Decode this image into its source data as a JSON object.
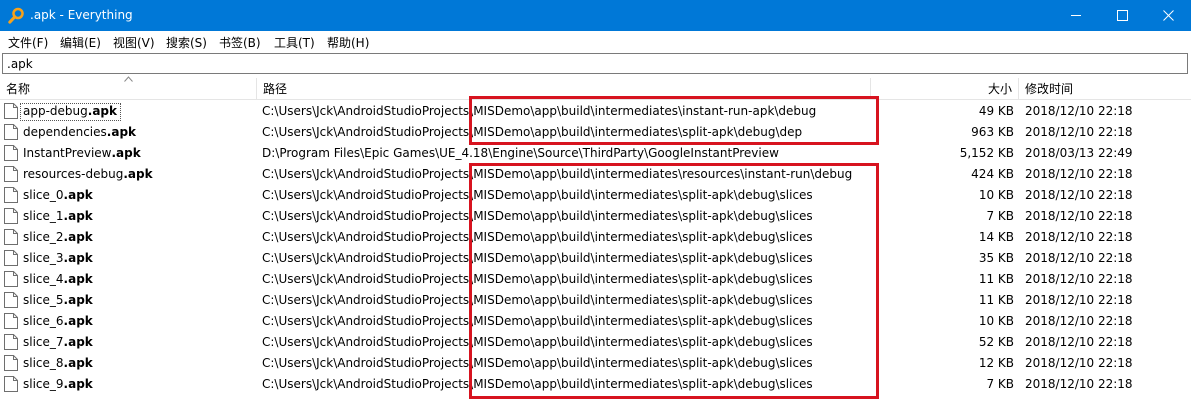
{
  "window": {
    "title": ".apk - Everything",
    "icon": "magnifier-icon"
  },
  "menu": [
    {
      "label": "文件(F)"
    },
    {
      "label": "编辑(E)"
    },
    {
      "label": "视图(V)"
    },
    {
      "label": "搜索(S)"
    },
    {
      "label": "书签(B)"
    },
    {
      "label": "工具(T)"
    },
    {
      "label": "帮助(H)"
    }
  ],
  "search": {
    "value": ".apk"
  },
  "columns": {
    "name": "名称",
    "path": "路径",
    "size": "大小",
    "modified": "修改时间"
  },
  "rows": [
    {
      "base": "app-debug",
      "ext": ".apk",
      "path": "C:\\Users\\Jck\\AndroidStudioProjects\\MISDemo\\app\\build\\intermediates\\instant-run-apk\\debug",
      "size": "49 KB",
      "date": "2018/12/10 22:18"
    },
    {
      "base": "dependencies",
      "ext": ".apk",
      "path": "C:\\Users\\Jck\\AndroidStudioProjects\\MISDemo\\app\\build\\intermediates\\split-apk\\debug\\dep",
      "size": "963 KB",
      "date": "2018/12/10 22:18"
    },
    {
      "base": "InstantPreview",
      "ext": ".apk",
      "path": "D:\\Program Files\\Epic Games\\UE_4.18\\Engine\\Source\\ThirdParty\\GoogleInstantPreview",
      "size": "5,152 KB",
      "date": "2018/03/13 22:49"
    },
    {
      "base": "resources-debug",
      "ext": ".apk",
      "path": "C:\\Users\\Jck\\AndroidStudioProjects\\MISDemo\\app\\build\\intermediates\\resources\\instant-run\\debug",
      "size": "424 KB",
      "date": "2018/12/10 22:18"
    },
    {
      "base": "slice_0",
      "ext": ".apk",
      "path": "C:\\Users\\Jck\\AndroidStudioProjects\\MISDemo\\app\\build\\intermediates\\split-apk\\debug\\slices",
      "size": "10 KB",
      "date": "2018/12/10 22:18"
    },
    {
      "base": "slice_1",
      "ext": ".apk",
      "path": "C:\\Users\\Jck\\AndroidStudioProjects\\MISDemo\\app\\build\\intermediates\\split-apk\\debug\\slices",
      "size": "7 KB",
      "date": "2018/12/10 22:18"
    },
    {
      "base": "slice_2",
      "ext": ".apk",
      "path": "C:\\Users\\Jck\\AndroidStudioProjects\\MISDemo\\app\\build\\intermediates\\split-apk\\debug\\slices",
      "size": "14 KB",
      "date": "2018/12/10 22:18"
    },
    {
      "base": "slice_3",
      "ext": ".apk",
      "path": "C:\\Users\\Jck\\AndroidStudioProjects\\MISDemo\\app\\build\\intermediates\\split-apk\\debug\\slices",
      "size": "35 KB",
      "date": "2018/12/10 22:18"
    },
    {
      "base": "slice_4",
      "ext": ".apk",
      "path": "C:\\Users\\Jck\\AndroidStudioProjects\\MISDemo\\app\\build\\intermediates\\split-apk\\debug\\slices",
      "size": "11 KB",
      "date": "2018/12/10 22:18"
    },
    {
      "base": "slice_5",
      "ext": ".apk",
      "path": "C:\\Users\\Jck\\AndroidStudioProjects\\MISDemo\\app\\build\\intermediates\\split-apk\\debug\\slices",
      "size": "11 KB",
      "date": "2018/12/10 22:18"
    },
    {
      "base": "slice_6",
      "ext": ".apk",
      "path": "C:\\Users\\Jck\\AndroidStudioProjects\\MISDemo\\app\\build\\intermediates\\split-apk\\debug\\slices",
      "size": "10 KB",
      "date": "2018/12/10 22:18"
    },
    {
      "base": "slice_7",
      "ext": ".apk",
      "path": "C:\\Users\\Jck\\AndroidStudioProjects\\MISDemo\\app\\build\\intermediates\\split-apk\\debug\\slices",
      "size": "52 KB",
      "date": "2018/12/10 22:18"
    },
    {
      "base": "slice_8",
      "ext": ".apk",
      "path": "C:\\Users\\Jck\\AndroidStudioProjects\\MISDemo\\app\\build\\intermediates\\split-apk\\debug\\slices",
      "size": "12 KB",
      "date": "2018/12/10 22:18"
    },
    {
      "base": "slice_9",
      "ext": ".apk",
      "path": "C:\\Users\\Jck\\AndroidStudioProjects\\MISDemo\\app\\build\\intermediates\\split-apk\\debug\\slices",
      "size": "7 KB",
      "date": "2018/12/10 22:18"
    }
  ],
  "colors": {
    "titlebar": "#0078d7",
    "highlight": "#d7131f"
  }
}
